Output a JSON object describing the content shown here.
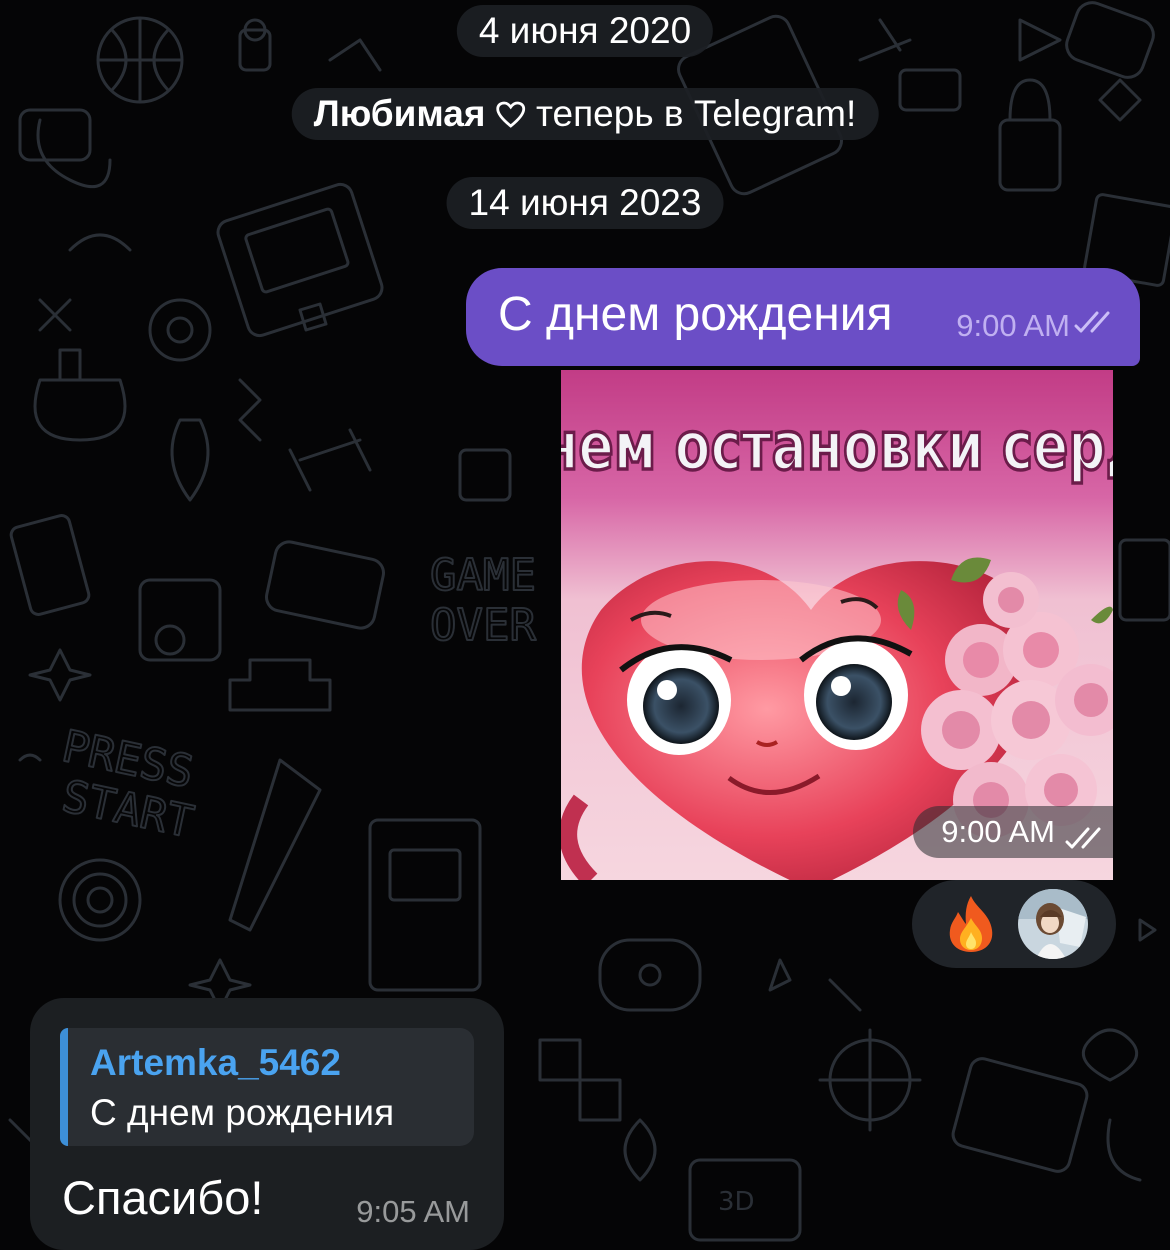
{
  "chat": {
    "date_1": "4 июня 2020",
    "service_name": "Любимая",
    "service_suffix": "теперь в Telegram!",
    "date_2": "14 июня 2023"
  },
  "outgoing": {
    "text": "С днем рождения",
    "time": "9:00 AM",
    "status": "read-double-check"
  },
  "sticker": {
    "caption_text": "с днем остановки сердца",
    "time": "9:00 AM",
    "status": "read-double-check"
  },
  "reactions": [
    {
      "emoji": "🔥",
      "icon": "fire-icon"
    },
    {
      "icon": "user-avatar"
    }
  ],
  "incoming": {
    "reply_name": "Artemka_5462",
    "reply_text": "С днем рождения",
    "text": "Спасибо!",
    "time": "9:05 AM"
  },
  "colors": {
    "background": "#050506",
    "outgoing_bubble": "#6b4ec6",
    "incoming_bubble": "#1c1f22",
    "reply_accent": "#4aa3f0",
    "service_chip": "#1c2024"
  }
}
